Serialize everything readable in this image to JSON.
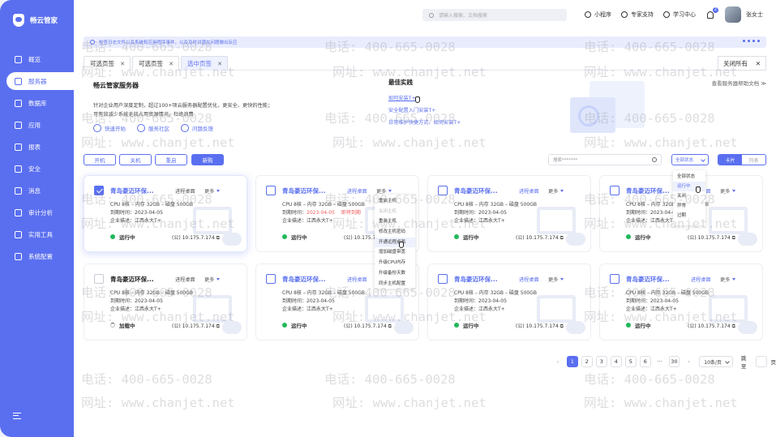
{
  "app": {
    "title": "畅云管家"
  },
  "sidebar": {
    "items": [
      {
        "label": "概览",
        "icon": "grid-icon"
      },
      {
        "label": "服务器",
        "icon": "cloud-icon",
        "active": true
      },
      {
        "label": "数据库",
        "icon": "database-icon"
      },
      {
        "label": "应用",
        "icon": "app-icon"
      },
      {
        "label": "报表",
        "icon": "report-icon"
      },
      {
        "label": "安全",
        "icon": "shield-icon"
      },
      {
        "label": "消息",
        "icon": "message-icon"
      },
      {
        "label": "审计分析",
        "icon": "chart-icon"
      },
      {
        "label": "实用工具",
        "icon": "toolbox-icon"
      },
      {
        "label": "系统配置",
        "icon": "gear-icon"
      }
    ]
  },
  "topbar": {
    "search_placeholder": "请输入搜索、文档搜索",
    "links": [
      "小程序",
      "专家支持",
      "学习中心"
    ],
    "notification_count": "2",
    "user": "张女士"
  },
  "notice": {
    "text": "检查日志文件以及系统和应用程序事件，以及及时对潜在问题做出反应"
  },
  "tabs": [
    {
      "label": "可选页签"
    },
    {
      "label": "可选页签"
    },
    {
      "label": "选中页签",
      "active": true
    }
  ],
  "close_all": "关闭所有",
  "intro": {
    "title": "畅云管家服务器",
    "desc_line1": "针对企业用户深度定制，超过100+项云服务器配置优化，更安全、更快的性能；",
    "desc_line2": "可有效减少系统无效占用资源情况，杜绝浪费",
    "links": [
      "快速开始",
      "服务社区",
      "问题反馈"
    ],
    "best_title": "最佳实践",
    "best_items": [
      "如何安装T+",
      "安全配置入门安装T+",
      "日常维护快捷方式、如何安装T+"
    ],
    "help_doc": "查看服务器帮助文档 ≫"
  },
  "toolbar": {
    "buttons": [
      "开机",
      "关机",
      "重启",
      "新购"
    ],
    "search_placeholder": "搜索*******",
    "status_select": "全部状态",
    "view_card": "卡片",
    "view_list": "列表"
  },
  "status_menu": [
    "全部状态",
    "运行中",
    "关闭",
    "异常",
    "过期"
  ],
  "more_menu": [
    "重启主机",
    "关闭主机",
    "重装主机",
    "修改主机密码",
    "开通远程桌面",
    "增加磁盘带宽",
    "升级CPU内存",
    "升级备份天数",
    "同步主机配置"
  ],
  "card_common": {
    "name": "青岛豪迈环保...",
    "remote": "进程桌面",
    "more": "更多",
    "spec": "CPU 8核 – 内存 32GB – 磁盘 500GB",
    "expire_label": "到期时间：",
    "expire_date": "2023-04-05",
    "renew": "即将到期",
    "company_label": "企业描述：",
    "company": "江西永大T+",
    "ip": "(公) 10.175.7.174"
  },
  "cards": [
    {
      "status": "运行中",
      "checked": true
    },
    {
      "status": "运行中",
      "expiring": true
    },
    {
      "status": "运行中"
    },
    {
      "status": "运行中"
    },
    {
      "status": "加载中",
      "loading": true
    },
    {
      "status": "运行中"
    },
    {
      "status": "运行中"
    },
    {
      "status": "运行中"
    }
  ],
  "pager": {
    "prev": "‹",
    "pages": [
      "1",
      "2",
      "3",
      "4",
      "5",
      "6"
    ],
    "ellipsis": "···",
    "last": "30",
    "next": "›",
    "per_page": "10条/页",
    "jump_label": "跳至",
    "page_unit": "页"
  },
  "watermark": {
    "phone": "电话: 400-665-0028",
    "url": "网址: www.chanjet.net"
  },
  "colors": {
    "primary": "#5a6ff0",
    "running": "#22b85a",
    "expiring": "#f05a5a"
  }
}
